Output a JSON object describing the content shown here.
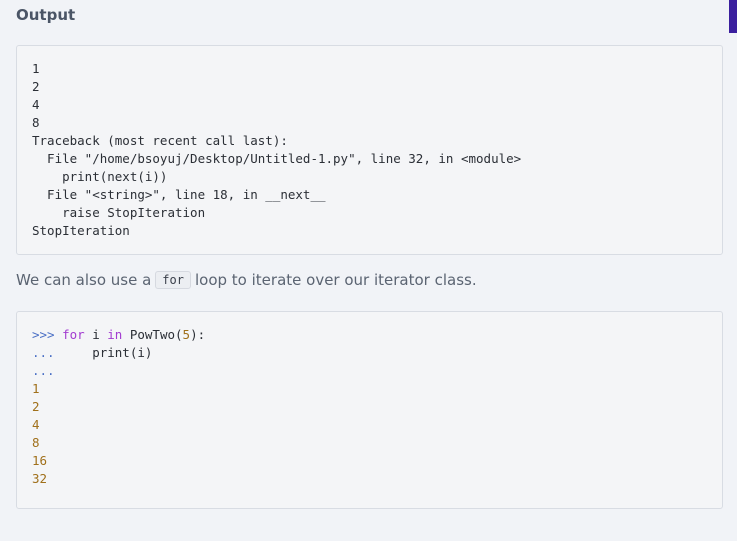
{
  "heading": "Output",
  "output_block": {
    "lines": [
      "1",
      "2",
      "4",
      "8",
      "Traceback (most recent call last):",
      "  File \"/home/bsoyuj/Desktop/Untitled-1.py\", line 32, in <module>",
      "    print(next(i))",
      "  File \"<string>\", line 18, in __next__",
      "    raise StopIteration",
      "StopIteration"
    ]
  },
  "prose": {
    "before": "We can also use a",
    "code": "for",
    "after": "loop to iterate over our iterator class."
  },
  "repl_block": {
    "line1": {
      "prompt": ">>>",
      "keyword_for": "for",
      "var": " i ",
      "keyword_in": "in",
      "call": " PowTwo(",
      "arg": "5",
      "end": "):"
    },
    "line2": {
      "prompt": "...",
      "body": "     print(i)"
    },
    "line3": {
      "prompt": "..."
    },
    "results": [
      "1",
      "2",
      "4",
      "8",
      "16",
      "32"
    ]
  },
  "colors": {
    "prompt": "#4a6fc5",
    "keyword": "#a23bd0",
    "number": "#a0701b",
    "accent": "#3b1f9e"
  }
}
